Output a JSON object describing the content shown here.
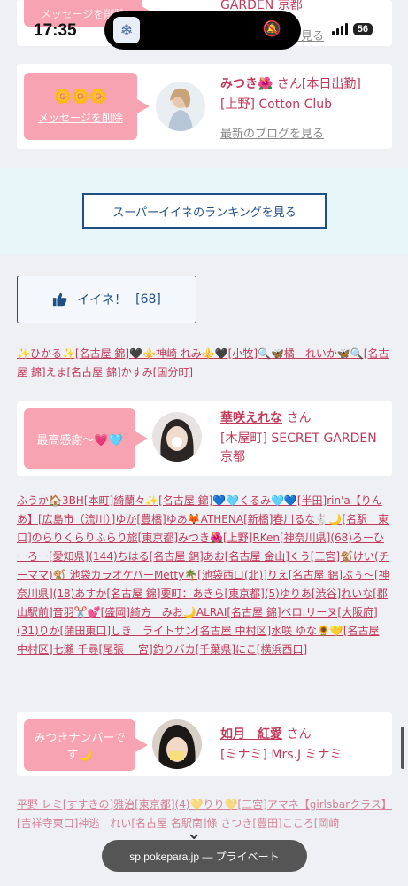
{
  "status": {
    "time": "17:35",
    "battery": "56"
  },
  "top_card": {
    "label": "メッセージを削除",
    "shop": "GARDEN 京都",
    "blog": "最新のブログを見る"
  },
  "card1": {
    "emoji": "🌼🌼🌼",
    "delete": "メッセージを削除",
    "name": "みつき🌺",
    "suffix": " さん[本日出勤]",
    "shop": "[上野] Cotton Club",
    "blog": "最新のブログを見る"
  },
  "ranking_button": "スーパーイイネのランキングを見る",
  "iine": {
    "label": "イイネ！",
    "count": "[68]"
  },
  "list1": "✨ひかる✨[名古屋 錦]🖤⚜️神崎 れみ⚜️🖤[小牧]🔍🦋橘　れいか🦋🔍[名古屋 錦]えま[名古屋 錦]かすみ[国分町]",
  "card2": {
    "message": "最高感謝〜💗🩵",
    "name": "華咲えれな",
    "suffix": " さん",
    "shop": "[木屋町] SECRET GARDEN 京都"
  },
  "list2": "ふうか🏠3BH[本町]綺蘭々✨[名古屋 錦]💙🩵くるみ🩵💙[半田]rin'a【りんあ】[広島市（流川）]ゆか[豊橋]ゆあ🦊ATHENA[新橋]春川るな🐇🌙[名駅　東口]のらりくらりふらり旅[東京都]みつき🌺[上野]RKen[神奈川県](68)ろーひーろー[愛知県](144)ちはる[名古屋 錦]あお[名古屋 金山]くう[三宮]🐒けい(チーママ)🐒 池袋カラオケバーMetty🌴[池袋西口(北)]りえ[名古屋 錦]ぶぅ〜[神奈川県](18)あすか[名古屋 錦]要町：あきら[東京都](5)ゆりあ[渋谷]れいな[郡山駅前]音羽✂️💕[盛岡]綺方　みお🌙ALRAI[名古屋 錦]ベロ.リーヌ[大阪府](31)りか[蒲田東口]しき　ライトサン[名古屋 中村区]水咲 ゆな🌻💛[名古屋 中村区]七瀬 千尋[尾張 一宮]釣りバカ[千葉県]にこ[横浜西口]",
  "card3": {
    "message": "みつきナンバーです🌙",
    "name": "如月　紅愛",
    "suffix": " さん",
    "shop": "[ミナミ] Mrs.J ミナミ"
  },
  "list3": "平野 レミ[すすきの]雅治[東京都](4)💛りり💛[三宮]アマネ【girlsbarクラス】[吉祥寺東口]神逃　れい[名古屋 名駅南]條 さつき[豊田]こころ[岡崎",
  "safari": "sp.pokepara.jp — プライベート"
}
